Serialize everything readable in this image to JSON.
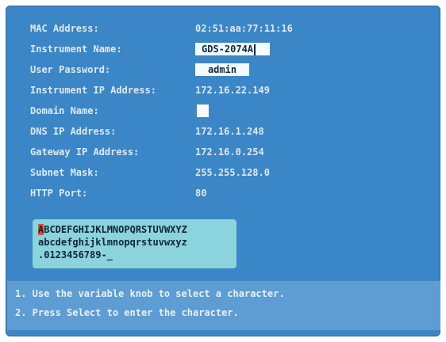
{
  "settings": {
    "mac_address": {
      "label": "MAC Address:",
      "value": "02:51:aa:77:11:16"
    },
    "instrument_name": {
      "label": "Instrument Name:",
      "value": "GDS-2074A"
    },
    "user_password": {
      "label": "User Password:",
      "value": "admin"
    },
    "instrument_ip": {
      "label": "Instrument IP Address:",
      "value": "172.16.22.149"
    },
    "domain_name": {
      "label": "Domain Name:",
      "value": ""
    },
    "dns_ip": {
      "label": "DNS IP Address:",
      "value": "172.16.1.248"
    },
    "gateway_ip": {
      "label": "Gateway IP Address:",
      "value": "172.16.0.254"
    },
    "subnet_mask": {
      "label": "Subnet Mask:",
      "value": "255.255.128.0"
    },
    "http_port": {
      "label": "HTTP Port:",
      "value": "80"
    }
  },
  "keyboard": {
    "selected_char": "A",
    "line1_rest": "BCDEFGHIJKLMNOPQRSTUVWXYZ",
    "line2": "abcdefghijklmnopqrstuvwxyz",
    "line3": ".0123456789-_"
  },
  "instructions": {
    "step1": "1. Use the variable knob to select a character.",
    "step2": "2. Press Select to enter the character."
  },
  "colors": {
    "panel": "#3b86c6",
    "keyboard": "#8bd3dd",
    "selection": "#d9531e",
    "field": "#f4fbff"
  }
}
